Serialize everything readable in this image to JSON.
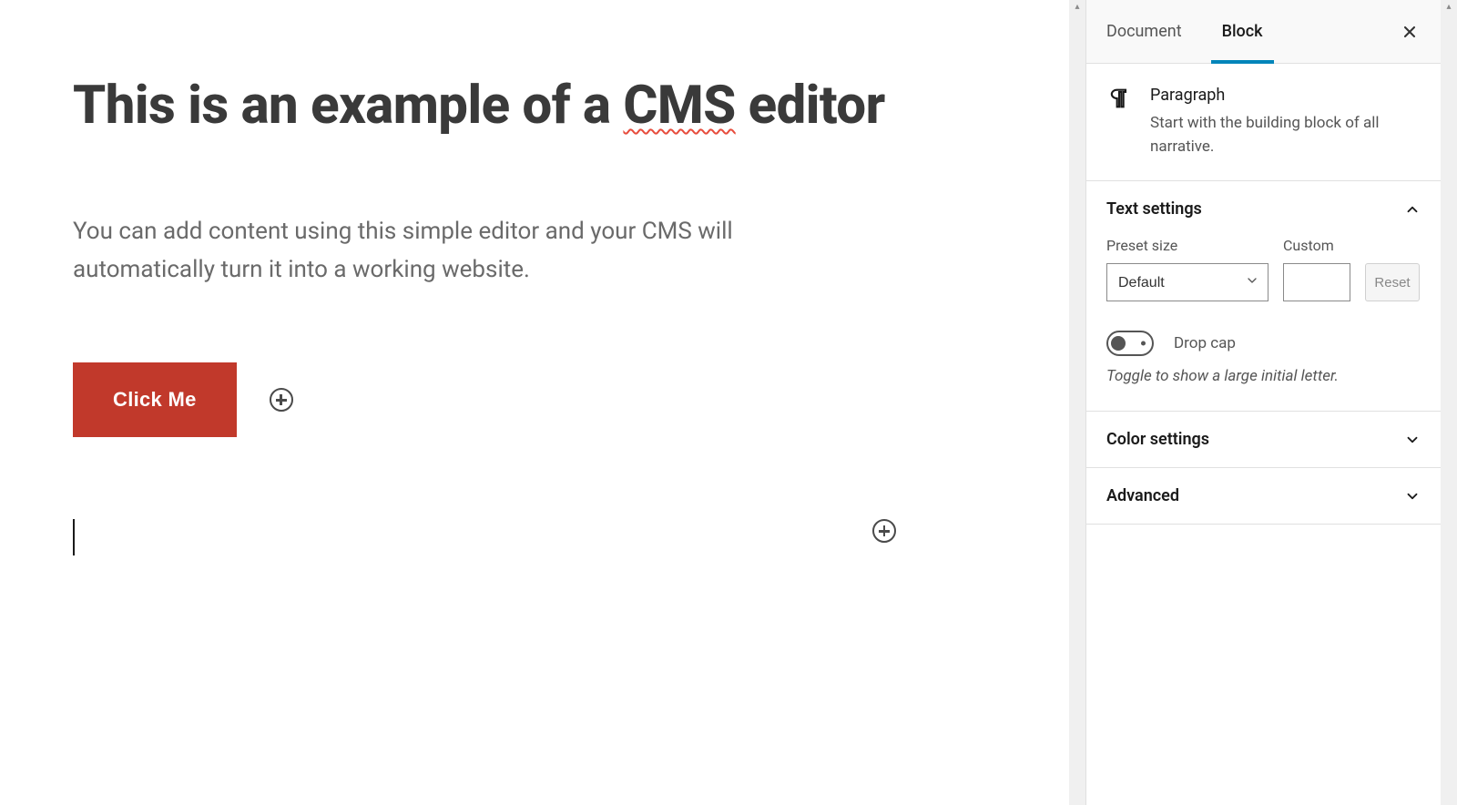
{
  "editor": {
    "title_pre": "This is an example of a ",
    "title_spell": "CMS",
    "title_post": " editor",
    "paragraph": "You can add content using this simple editor and your CMS will automatically turn it into a working website.",
    "button_label": "Click Me"
  },
  "sidebar": {
    "tabs": {
      "document": "Document",
      "block": "Block"
    },
    "block_info": {
      "title": "Paragraph",
      "description": "Start with the building block of all narrative."
    },
    "panels": {
      "text_settings": {
        "title": "Text settings",
        "preset_label": "Preset size",
        "preset_value": "Default",
        "custom_label": "Custom",
        "custom_value": "",
        "reset_label": "Reset",
        "dropcap_label": "Drop cap",
        "dropcap_help": "Toggle to show a large initial letter."
      },
      "color_settings": {
        "title": "Color settings"
      },
      "advanced": {
        "title": "Advanced"
      }
    }
  }
}
